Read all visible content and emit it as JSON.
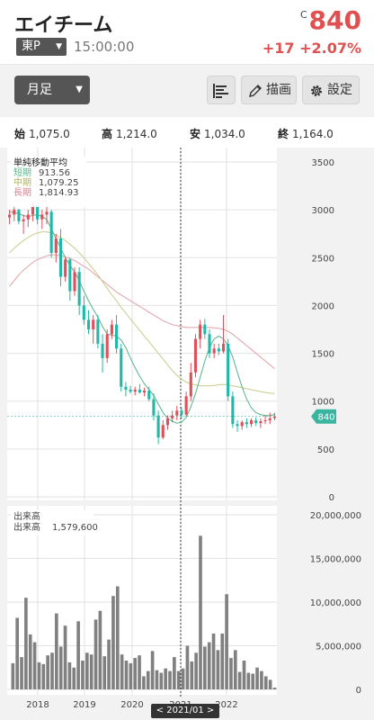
{
  "header": {
    "stock_name": "エイチーム",
    "market": "東P",
    "time": "15:00:00",
    "price_mark": "C",
    "price": "840",
    "change": "+17 +2.07%"
  },
  "toolbar": {
    "period": "月足",
    "draw_label": "描画",
    "settings_label": "設定"
  },
  "ohlc": {
    "open_label": "始",
    "open": "1,075.0",
    "high_label": "高",
    "high": "1,214.0",
    "low_label": "安",
    "low": "1,034.0",
    "close_label": "終",
    "close": "1,164.0"
  },
  "legend": {
    "title": "単純移動平均",
    "short_label": "短期",
    "short_value": "913.56",
    "mid_label": "中期",
    "mid_value": "1,079.25",
    "long_label": "長期",
    "long_value": "1,814.93"
  },
  "volume_legend": {
    "title": "出来高",
    "label": "出来高",
    "value": "1,579,600"
  },
  "period_nav": "< 2021/01 >",
  "colors": {
    "up": "#e0505a",
    "down": "#22b8a8",
    "sma_short": "#55b58a",
    "sma_mid": "#c8cc88",
    "sma_long": "#e0a0a8",
    "volume": "#808080",
    "current_tag": "#3ab5a0"
  },
  "chart_data": [
    {
      "type": "candlestick",
      "y_ticks": [
        "3500",
        "3000",
        "2500",
        "2000",
        "1500",
        "1000",
        "500",
        "0"
      ],
      "ylim": [
        0,
        3500
      ],
      "x_ticks": [
        "2018",
        "2019",
        "2020",
        "2021",
        "2022"
      ],
      "current_value": "840",
      "candles": [
        [
          2920,
          3000,
          2850,
          2950
        ],
        [
          2950,
          3050,
          2880,
          3000
        ],
        [
          3000,
          3010,
          2850,
          2880
        ],
        [
          2880,
          2950,
          2750,
          2900
        ],
        [
          2900,
          3000,
          2820,
          2950
        ],
        [
          2950,
          3080,
          2880,
          3050
        ],
        [
          3050,
          3060,
          2850,
          2900
        ],
        [
          2900,
          3000,
          2800,
          2950
        ],
        [
          2950,
          3030,
          2850,
          2980
        ],
        [
          2980,
          3000,
          2500,
          2550
        ],
        [
          2550,
          2750,
          2450,
          2700
        ],
        [
          2700,
          2800,
          2200,
          2300
        ],
        [
          2300,
          2500,
          2250,
          2480
        ],
        [
          2480,
          2500,
          2050,
          2150
        ],
        [
          2150,
          2400,
          2100,
          2350
        ],
        [
          2350,
          2400,
          1900,
          2000
        ],
        [
          2000,
          2100,
          1800,
          1850
        ],
        [
          1850,
          1950,
          1700,
          1750
        ],
        [
          1750,
          1900,
          1600,
          1850
        ],
        [
          1850,
          1900,
          1550,
          1600
        ],
        [
          1600,
          1700,
          1300,
          1450
        ],
        [
          1450,
          1750,
          1400,
          1700
        ],
        [
          1700,
          1850,
          1650,
          1800
        ],
        [
          1800,
          1900,
          1500,
          1550
        ],
        [
          1550,
          1600,
          1100,
          1150
        ],
        [
          1150,
          1200,
          1050,
          1120
        ],
        [
          1120,
          1160,
          1080,
          1100
        ],
        [
          1100,
          1150,
          1060,
          1120
        ],
        [
          1120,
          1180,
          1080,
          1090
        ],
        [
          1090,
          1140,
          1050,
          1110
        ],
        [
          1110,
          1150,
          1000,
          1020
        ],
        [
          1020,
          1080,
          800,
          850
        ],
        [
          850,
          900,
          550,
          620
        ],
        [
          620,
          800,
          600,
          750
        ],
        [
          750,
          850,
          700,
          820
        ],
        [
          820,
          900,
          780,
          850
        ],
        [
          850,
          950,
          800,
          900
        ],
        [
          900,
          930,
          820,
          860
        ],
        [
          860,
          1100,
          840,
          1050
        ],
        [
          1050,
          1400,
          1000,
          1300
        ],
        [
          1300,
          1700,
          1250,
          1650
        ],
        [
          1650,
          1850,
          1550,
          1800
        ],
        [
          1800,
          1860,
          1650,
          1700
        ],
        [
          1700,
          1750,
          1450,
          1500
        ],
        [
          1500,
          1600,
          1450,
          1550
        ],
        [
          1550,
          1600,
          1480,
          1520
        ],
        [
          1520,
          1900,
          1500,
          1600
        ],
        [
          1600,
          1650,
          1000,
          1050
        ],
        [
          1050,
          1100,
          720,
          760
        ],
        [
          760,
          800,
          680,
          740
        ],
        [
          740,
          800,
          700,
          780
        ],
        [
          780,
          820,
          720,
          760
        ],
        [
          760,
          820,
          730,
          800
        ],
        [
          800,
          830,
          740,
          770
        ],
        [
          770,
          820,
          720,
          790
        ],
        [
          790,
          850,
          760,
          800
        ],
        [
          800,
          880,
          760,
          820
        ],
        [
          823,
          880,
          800,
          840
        ]
      ],
      "sma_short": [
        2980,
        2970,
        2960,
        2940,
        2930,
        2940,
        2950,
        2930,
        2900,
        2800,
        2700,
        2600,
        2500,
        2420,
        2350,
        2260,
        2150,
        2050,
        1960,
        1880,
        1780,
        1700,
        1690,
        1680,
        1640,
        1560,
        1450,
        1350,
        1260,
        1180,
        1120,
        1060,
        970,
        880,
        820,
        790,
        770,
        780,
        830,
        940,
        1080,
        1250,
        1420,
        1560,
        1650,
        1680,
        1650,
        1580,
        1460,
        1300,
        1150,
        1020,
        930,
        880,
        860,
        850,
        850,
        860
      ],
      "sma_mid": [
        2550,
        2600,
        2640,
        2680,
        2710,
        2740,
        2760,
        2770,
        2770,
        2760,
        2740,
        2710,
        2680,
        2640,
        2600,
        2550,
        2500,
        2440,
        2380,
        2320,
        2250,
        2180,
        2110,
        2050,
        1980,
        1920,
        1860,
        1800,
        1740,
        1680,
        1620,
        1560,
        1500,
        1440,
        1380,
        1320,
        1270,
        1230,
        1200,
        1180,
        1170,
        1160,
        1160,
        1160,
        1165,
        1170,
        1175,
        1170,
        1160,
        1150,
        1140,
        1130,
        1120,
        1110,
        1100,
        1090,
        1085,
        1080
      ],
      "sma_long": [
        2200,
        2260,
        2320,
        2370,
        2410,
        2450,
        2480,
        2500,
        2520,
        2530,
        2530,
        2520,
        2510,
        2490,
        2470,
        2440,
        2410,
        2380,
        2340,
        2300,
        2260,
        2220,
        2180,
        2140,
        2110,
        2080,
        2050,
        2020,
        1990,
        1960,
        1930,
        1900,
        1870,
        1840,
        1820,
        1800,
        1790,
        1780,
        1770,
        1770,
        1770,
        1770,
        1770,
        1770,
        1765,
        1760,
        1750,
        1730,
        1700,
        1660,
        1620,
        1580,
        1540,
        1500,
        1460,
        1420,
        1380,
        1340
      ]
    },
    {
      "type": "bar",
      "y_ticks": [
        "20,000,000",
        "15,000,000",
        "10,000,000",
        "5,000,000",
        "0"
      ],
      "ylim": [
        0,
        20000000
      ],
      "values": [
        3000000,
        8200000,
        3700000,
        10500000,
        6300000,
        5400000,
        3100000,
        2900000,
        3900000,
        4200000,
        8700000,
        4900000,
        7300000,
        3100000,
        2500000,
        7800000,
        3300000,
        4200000,
        4000000,
        8000000,
        9000000,
        3800000,
        5700000,
        10700000,
        11800000,
        4000000,
        3300000,
        3000000,
        3600000,
        3900000,
        1500000,
        2100000,
        4400000,
        2200000,
        1900000,
        2400000,
        2100000,
        3700000,
        2100000,
        2400000,
        5000000,
        3200000,
        4200000,
        17600000,
        4900000,
        5400000,
        6400000,
        4500000,
        6400000,
        10900000,
        3600000,
        4500000,
        2000000,
        3300000,
        1900000,
        1800000,
        2500000,
        2100000,
        1500000,
        1100000,
        200000
      ]
    }
  ]
}
